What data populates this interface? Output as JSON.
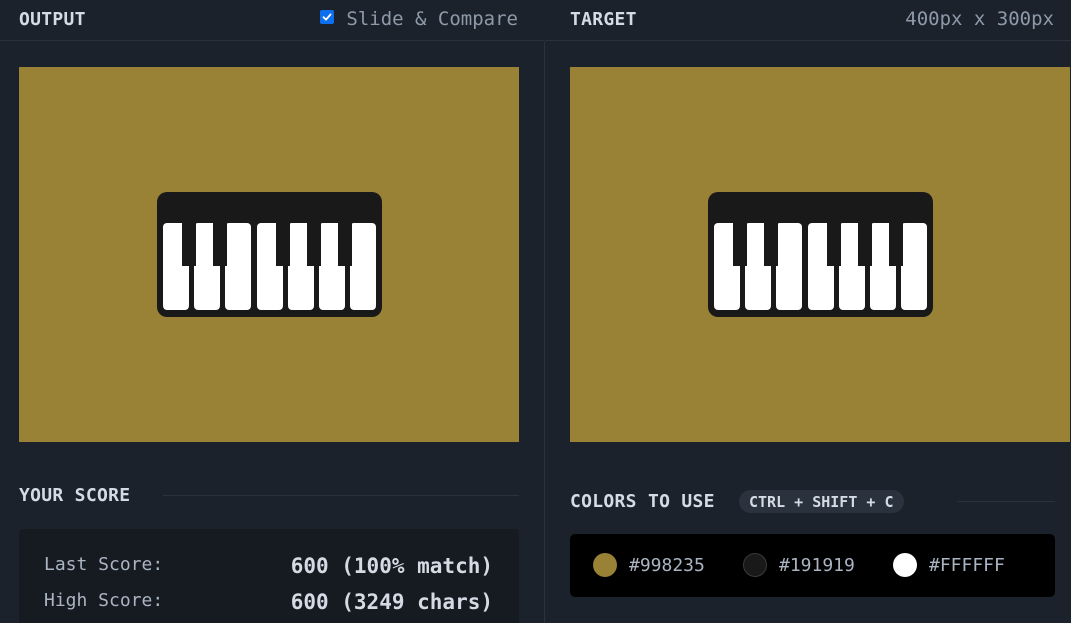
{
  "output": {
    "title": "OUTPUT",
    "slide_compare_label": "Slide & Compare",
    "slide_compare_checked": true
  },
  "target": {
    "title": "TARGET",
    "dimensions": "400px x 300px"
  },
  "canvas": {
    "background": "#998235",
    "piano_body_color": "#191919",
    "key_color": "#FFFFFF"
  },
  "score": {
    "title": "YOUR SCORE",
    "last_label": "Last Score:",
    "last_value": "600 (100% match)",
    "high_label": "High Score:",
    "high_value": "600 (3249 chars)"
  },
  "colors": {
    "title": "COLORS TO USE",
    "shortcut": "CTRL + SHIFT + C",
    "items": [
      {
        "hex": "#998235",
        "label": "#998235"
      },
      {
        "hex": "#191919",
        "label": "#191919"
      },
      {
        "hex": "#FFFFFF",
        "label": "#FFFFFF"
      }
    ]
  }
}
